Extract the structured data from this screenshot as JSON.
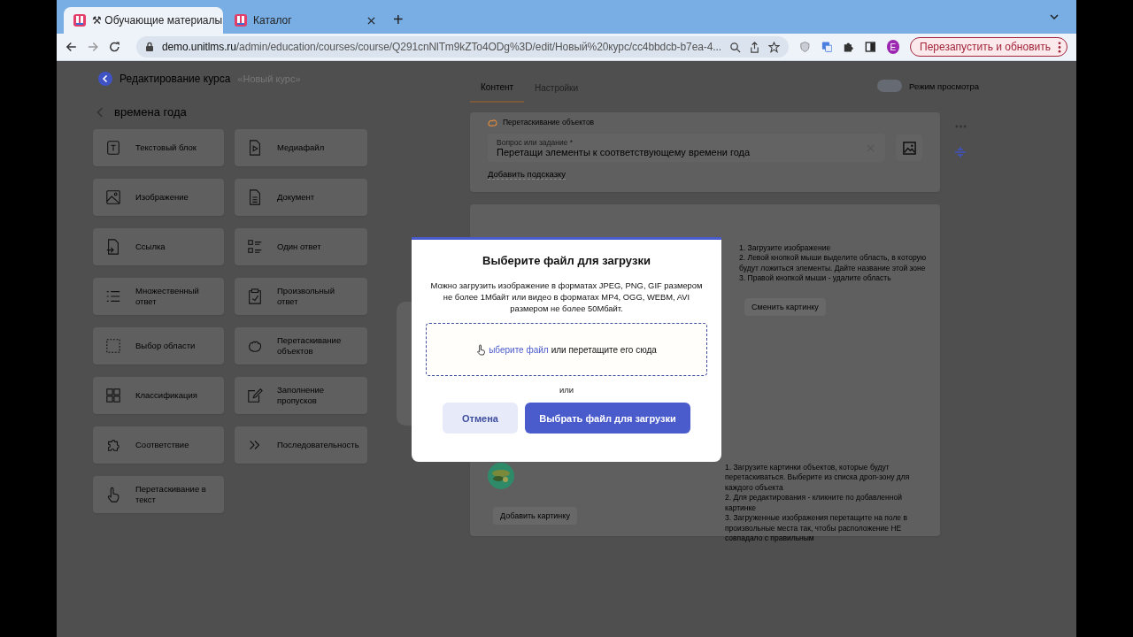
{
  "browser": {
    "tabs": [
      {
        "title": "⚒ Обучающие материалы",
        "selected": true
      },
      {
        "title": "Каталог",
        "selected": false
      }
    ],
    "new_tab": "+",
    "url_host": "demo.unitlms.ru",
    "url_path": "/admin/education/courses/course/Q291cnNlTm9kZTo4ODg%3D/edit/Новый%20курс/cc4bbdcb-b7ea-4...",
    "profile_initial": "E",
    "relaunch_button": "Перезапустить и обновить"
  },
  "header": {
    "title": "Редактирование курса",
    "course": "«Новый курс»"
  },
  "section": {
    "title": "времена года"
  },
  "blocks": [
    "Текстовый блок",
    "Медиафайл",
    "Изображение",
    "Документ",
    "Ссылка",
    "Один ответ",
    "Множественный ответ",
    "Произвольный ответ",
    "Выбор области",
    "Перетаскивание объектов",
    "Классификация",
    "Заполнение пропусков",
    "Соответствие",
    "Последовательность",
    "Перетаскивание в текст"
  ],
  "tabs": [
    {
      "label": "Контент",
      "selected": true
    },
    {
      "label": "Настройки",
      "selected": false
    }
  ],
  "preview_mode": {
    "label": "Режим просмотра",
    "on": false
  },
  "question_card": {
    "type": "Перетаскивание объектов",
    "field_label": "Вопрос или задание *",
    "field_value": "Перетащи элементы к соответствующему времени года",
    "hint_link": "Добавить подсказку"
  },
  "area_section": {
    "instructions": [
      "1. Загрузите изображение",
      "2. Левой кнопкой мыши выделите область, в которую будут ложиться элементы. Дайте название этой зоне",
      "3. Правой кнопкой мыши - удалите область"
    ],
    "change_button": "Сменить картинку"
  },
  "objects_section": {
    "add_button": "Добавить картинку",
    "instructions": [
      "1. Загрузите картинки объектов, которые будут перетаскиваться. Выберите из списка дроп-зону для каждого объекта",
      "2. Для редактирования - кликните по добавленной картинке",
      "3. Загруженные изображения перетащите на поле в произвольные места так, чтобы расположение НЕ совпадало с правильным"
    ]
  },
  "modal": {
    "title": "Выберите файл для загрузки",
    "description": "Можно загрузить изображение в форматах JPEG, PNG, GIF размером не более 1Мбайт или видео в форматах MP4, OGG, WEBM, AVI размером не более 50Мбайт.",
    "drop_link": "ыберите файл",
    "drop_text": "или перетащите его сюда",
    "or": "или",
    "cancel": "Отмена",
    "confirm": "Выбрать файл для загрузки"
  }
}
